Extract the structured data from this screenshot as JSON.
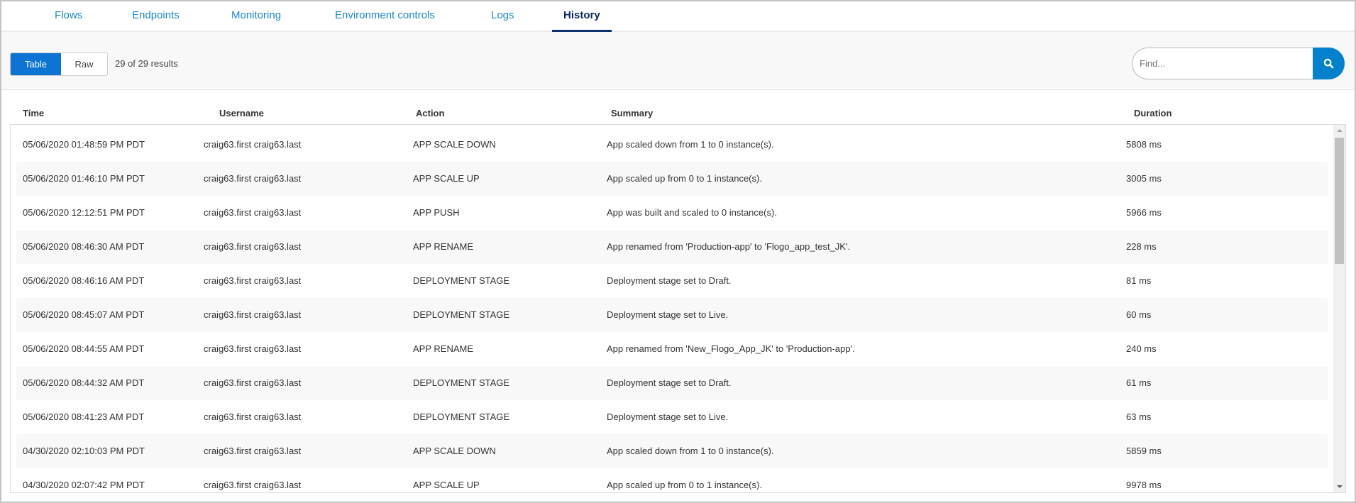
{
  "tabs": [
    {
      "label": "Flows",
      "active": false
    },
    {
      "label": "Endpoints",
      "active": false
    },
    {
      "label": "Monitoring",
      "active": false
    },
    {
      "label": "Environment controls",
      "active": false
    },
    {
      "label": "Logs",
      "active": false
    },
    {
      "label": "History",
      "active": true
    }
  ],
  "toolbar": {
    "view_toggle": {
      "table_label": "Table",
      "raw_label": "Raw",
      "selected": "Table"
    },
    "results_text": "29 of 29 results",
    "search": {
      "placeholder": "Find...",
      "value": "",
      "icon": "search-icon"
    }
  },
  "colors": {
    "accent": "#0381cc",
    "toggle_active": "#0d74d4",
    "tab_link": "#1e87c8",
    "tab_active": "#0d2f6e"
  },
  "table": {
    "columns": [
      "Time",
      "Username",
      "Action",
      "Summary",
      "Duration"
    ],
    "rows": [
      {
        "time": "05/06/2020 01:48:59 PM PDT",
        "username": "craig63.first craig63.last",
        "action": "APP SCALE DOWN",
        "summary": "App scaled down from 1 to 0 instance(s).",
        "duration": "5808 ms"
      },
      {
        "time": "05/06/2020 01:46:10 PM PDT",
        "username": "craig63.first craig63.last",
        "action": "APP SCALE UP",
        "summary": "App scaled up from 0 to 1 instance(s).",
        "duration": "3005 ms"
      },
      {
        "time": "05/06/2020 12:12:51 PM PDT",
        "username": "craig63.first craig63.last",
        "action": "APP PUSH",
        "summary": "App was built and scaled to 0 instance(s).",
        "duration": "5966 ms"
      },
      {
        "time": "05/06/2020 08:46:30 AM PDT",
        "username": "craig63.first craig63.last",
        "action": "APP RENAME",
        "summary": "App renamed from 'Production-app' to 'Flogo_app_test_JK'.",
        "duration": "228 ms"
      },
      {
        "time": "05/06/2020 08:46:16 AM PDT",
        "username": "craig63.first craig63.last",
        "action": "DEPLOYMENT STAGE",
        "summary": "Deployment stage set to Draft.",
        "duration": "81 ms"
      },
      {
        "time": "05/06/2020 08:45:07 AM PDT",
        "username": "craig63.first craig63.last",
        "action": "DEPLOYMENT STAGE",
        "summary": "Deployment stage set to Live.",
        "duration": "60 ms"
      },
      {
        "time": "05/06/2020 08:44:55 AM PDT",
        "username": "craig63.first craig63.last",
        "action": "APP RENAME",
        "summary": "App renamed from 'New_Flogo_App_JK' to 'Production-app'.",
        "duration": "240 ms"
      },
      {
        "time": "05/06/2020 08:44:32 AM PDT",
        "username": "craig63.first craig63.last",
        "action": "DEPLOYMENT STAGE",
        "summary": "Deployment stage set to Draft.",
        "duration": "61 ms"
      },
      {
        "time": "05/06/2020 08:41:23 AM PDT",
        "username": "craig63.first craig63.last",
        "action": "DEPLOYMENT STAGE",
        "summary": "Deployment stage set to Live.",
        "duration": "63 ms"
      },
      {
        "time": "04/30/2020 02:10:03 PM PDT",
        "username": "craig63.first craig63.last",
        "action": "APP SCALE DOWN",
        "summary": "App scaled down from 1 to 0 instance(s).",
        "duration": "5859 ms"
      },
      {
        "time": "04/30/2020 02:07:42 PM PDT",
        "username": "craig63.first craig63.last",
        "action": "APP SCALE UP",
        "summary": "App scaled up from 0 to 1 instance(s).",
        "duration": "9978 ms"
      }
    ]
  }
}
